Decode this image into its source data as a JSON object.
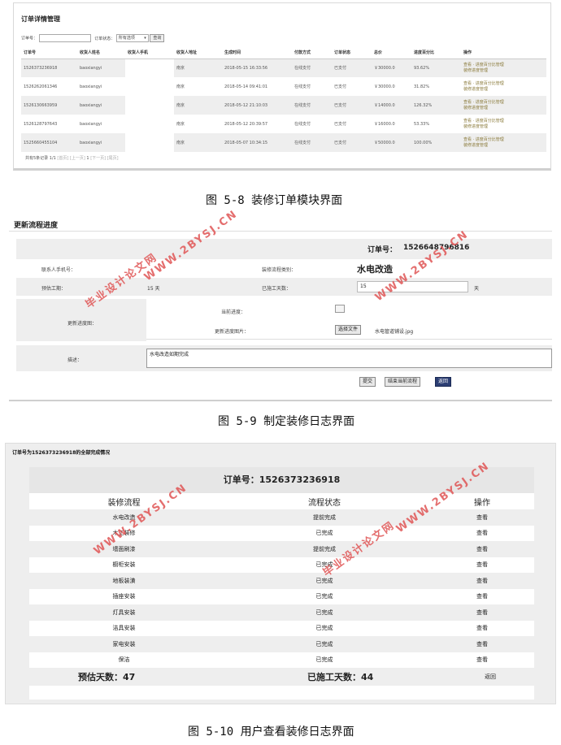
{
  "fig1": {
    "title": "订单详情管理",
    "filter_order_label": "订单号：",
    "filter_status_label": "订单状态：",
    "filter_status_value": "所有选项",
    "query_button": "查询",
    "columns": [
      "订单号",
      "收货人姓名",
      "收货人手机",
      "收货人地址",
      "生成时间",
      "付款方式",
      "订单状态",
      "总价",
      "进度百分比",
      "操作"
    ],
    "rows": [
      {
        "id": "1526373236918",
        "name": "baoxiangyi",
        "phone": "",
        "addr": "南京",
        "time": "2018-05-15 16:33:56",
        "pay": "在线支付",
        "status": "已支付",
        "total": "￥30000.0",
        "progress": "93.62%",
        "op1": "查看 · 进度百分比管理",
        "op2": "装修进度管理"
      },
      {
        "id": "1526262061346",
        "name": "baoxiangyi",
        "phone": "",
        "addr": "南京",
        "time": "2018-05-14 09:41:01",
        "pay": "在线支付",
        "status": "已支付",
        "total": "￥30000.0",
        "progress": "31.82%",
        "op1": "查看 · 进度百分比管理",
        "op2": "装修进度管理"
      },
      {
        "id": "1526130663959",
        "name": "baoxiangyi",
        "phone": "",
        "addr": "南京",
        "time": "2018-05-12 21:10:03",
        "pay": "在线支付",
        "status": "已支付",
        "total": "￥14000.0",
        "progress": "126.32%",
        "op1": "查看 · 进度百分比管理",
        "op2": "装修进度管理"
      },
      {
        "id": "1526128797643",
        "name": "baoxiangyi",
        "phone": "",
        "addr": "南京",
        "time": "2018-05-12 20:39:57",
        "pay": "在线支付",
        "status": "已支付",
        "total": "￥16000.0",
        "progress": "53.33%",
        "op1": "查看 · 进度百分比管理",
        "op2": "装修进度管理"
      },
      {
        "id": "1525660455104",
        "name": "baoxiangyi",
        "phone": "",
        "addr": "南京",
        "time": "2018-05-07 10:34:15",
        "pay": "在线支付",
        "status": "已支付",
        "total": "￥50000.0",
        "progress": "100.00%",
        "op1": "查看 · 进度百分比管理",
        "op2": "装修进度管理"
      }
    ],
    "pager_summary": "共有5条记录  1/1",
    "pager_first": "[首页]",
    "pager_prev": "[上一页]",
    "pager_current": "1",
    "pager_next": "[下一页]",
    "pager_last": "[尾页]"
  },
  "caption1": "图 5-8 装修订单模块界面",
  "fig2": {
    "title": "更新流程进度",
    "order_label": "订单号：",
    "order_no": "1526648796816",
    "contact_label": "联系人手机号：",
    "category_label": "装修流程类别：",
    "category_value": "水电改造",
    "est_label": "预估工期：",
    "est_value": "15  天",
    "done_label": "已施工天数：",
    "done_value": "15",
    "done_unit": "天",
    "pic_label": "更新进度图：",
    "current_label": "当前进度：",
    "newpic_label": "更新进度图片：",
    "choose_button": "选择文件",
    "file_name": "水电管道铺设.jpg",
    "desc_label": "描述：",
    "desc_value": "水电改造如期完成",
    "submit_button": "提交",
    "finish_button": "结束当前流程",
    "back_button": "返回"
  },
  "caption2": "图 5-9 制定装修日志界面",
  "fig3": {
    "title": "订单号为1526373236918的全部完成情况",
    "order_header": "订单号：1526373236918",
    "columns": [
      "装修流程",
      "流程状态",
      "操作"
    ],
    "rows": [
      {
        "step": "水电改造",
        "status": "提前完成",
        "op": "查看"
      },
      {
        "step": "木工装修",
        "status": "已完成",
        "op": "查看"
      },
      {
        "step": "墙面刷漆",
        "status": "提前完成",
        "op": "查看"
      },
      {
        "step": "橱柜安装",
        "status": "已完成",
        "op": "查看"
      },
      {
        "step": "地板装潢",
        "status": "已完成",
        "op": "查看"
      },
      {
        "step": "插座安装",
        "status": "已完成",
        "op": "查看"
      },
      {
        "step": "灯具安装",
        "status": "已完成",
        "op": "查看"
      },
      {
        "step": "洁具安装",
        "status": "已完成",
        "op": "查看"
      },
      {
        "step": "家电安装",
        "status": "已完成",
        "op": "查看"
      },
      {
        "step": "保洁",
        "status": "已完成",
        "op": "查看"
      }
    ],
    "est_days": "预估天数：47",
    "done_days": "已施工天数：44",
    "back": "返回"
  },
  "caption3": "图 5-10 用户查看装修日志界面",
  "watermark_url": "WWW.2BYSJ.CN",
  "watermark_site": "毕业设计论文网",
  "watermark_color": "#e05555"
}
